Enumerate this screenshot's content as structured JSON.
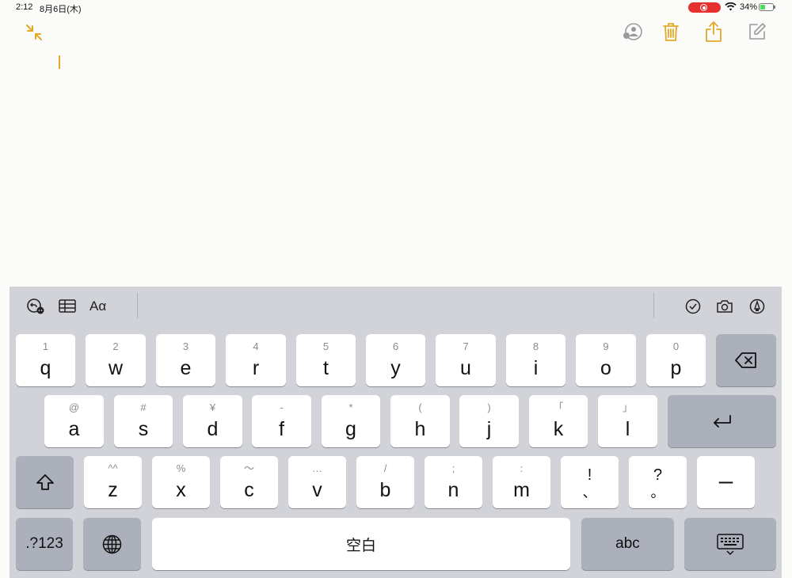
{
  "status_bar": {
    "time": "2:12",
    "date": "8月6日(木)",
    "battery_percent": "34%"
  },
  "toolbar": {
    "accent_color": "#e3a826",
    "icons": [
      "collapse-icon",
      "collaborate-icon",
      "trash-icon",
      "share-icon",
      "compose-icon"
    ]
  },
  "note": {
    "text": ""
  },
  "accessory_bar": {
    "format_label": "Aα",
    "icons": [
      "undo-redo-icon",
      "table-icon",
      "checklist-icon",
      "camera-icon",
      "markup-icon"
    ]
  },
  "keyboard": {
    "row1": [
      {
        "hint": "1",
        "key": "q"
      },
      {
        "hint": "2",
        "key": "w"
      },
      {
        "hint": "3",
        "key": "e"
      },
      {
        "hint": "4",
        "key": "r"
      },
      {
        "hint": "5",
        "key": "t"
      },
      {
        "hint": "6",
        "key": "y"
      },
      {
        "hint": "7",
        "key": "u"
      },
      {
        "hint": "8",
        "key": "i"
      },
      {
        "hint": "9",
        "key": "o"
      },
      {
        "hint": "0",
        "key": "p"
      }
    ],
    "row2": [
      {
        "hint": "@",
        "key": "a"
      },
      {
        "hint": "#",
        "key": "s"
      },
      {
        "hint": "¥",
        "key": "d"
      },
      {
        "hint": "-",
        "key": "f"
      },
      {
        "hint": "*",
        "key": "g"
      },
      {
        "hint": "(",
        "key": "h"
      },
      {
        "hint": ")",
        "key": "j"
      },
      {
        "hint": "「",
        "key": "k"
      },
      {
        "hint": "」",
        "key": "l"
      }
    ],
    "row3": [
      {
        "hint": "^^",
        "key": "z"
      },
      {
        "hint": "%",
        "key": "x"
      },
      {
        "hint": "〜",
        "key": "c"
      },
      {
        "hint": "…",
        "key": "v"
      },
      {
        "hint": "/",
        "key": "b"
      },
      {
        "hint": ";",
        "key": "n"
      },
      {
        "hint": ":",
        "key": "m"
      }
    ],
    "punct": [
      {
        "top": "!",
        "bottom": "、"
      },
      {
        "top": "?",
        "bottom": "。"
      }
    ],
    "dash_key": "ー",
    "numbers_key": ".?123",
    "space_key": "空白",
    "abc_key": "abc"
  }
}
